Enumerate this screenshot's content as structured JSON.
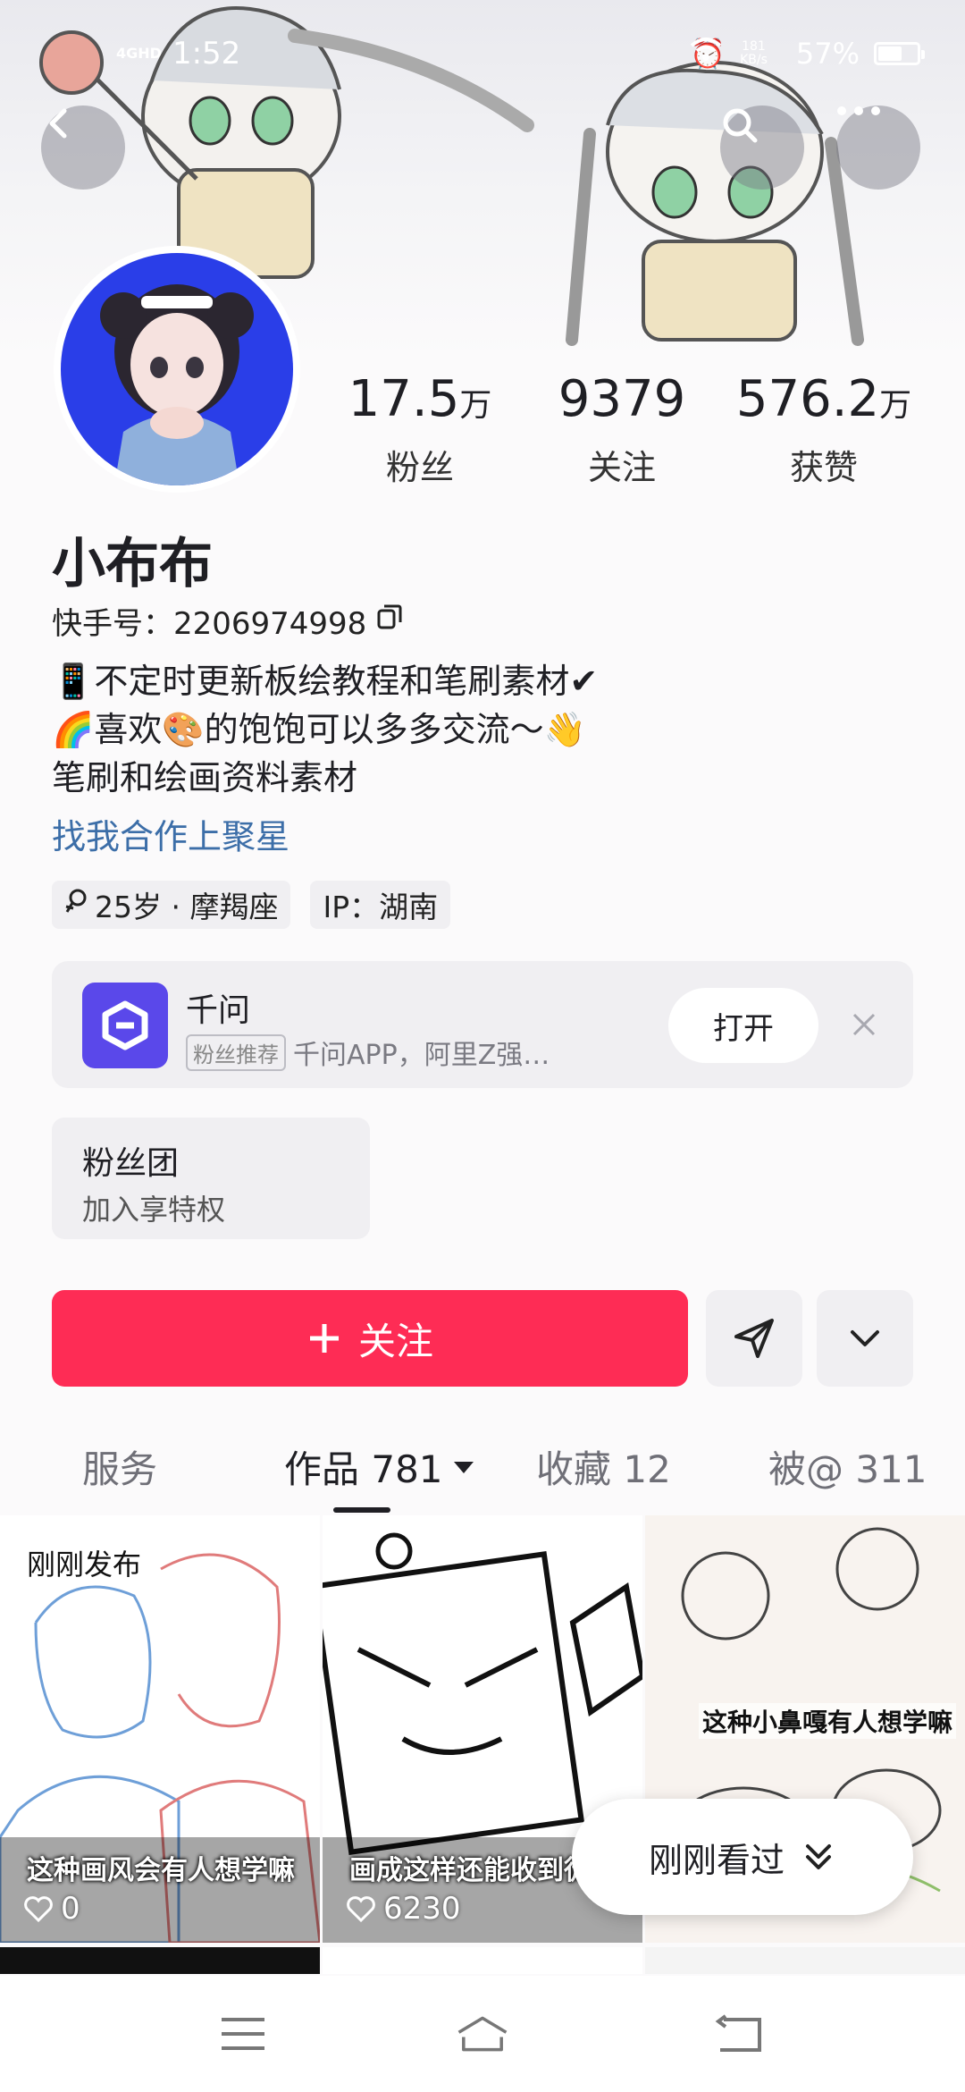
{
  "status_bar": {
    "network": "4GHD",
    "time": "1:52",
    "speed_value": "181",
    "speed_unit": "KB/s",
    "battery": "57%",
    "battery_level": 0.57
  },
  "header": {
    "back_icon": "back-arrow-icon",
    "search_icon": "search-icon",
    "more_icon": "more-dots-icon"
  },
  "profile": {
    "stats": [
      {
        "value": "17.5",
        "unit": "万",
        "label": "粉丝"
      },
      {
        "value": "9379",
        "unit": "",
        "label": "关注"
      },
      {
        "value": "576.2",
        "unit": "万",
        "label": "获赞"
      }
    ],
    "name": "小布布",
    "kuaishou_id": "快手号：2206974998",
    "bio_lines": [
      "📱不定时更新板绘教程和笔刷素材✔",
      "🌈喜欢🎨的饱饱可以多多交流～👋",
      "笔刷和绘画资料素材"
    ],
    "cooperation_link": "找我合作上聚星",
    "tags": [
      "25岁 · 摩羯座",
      "IP：湖南"
    ]
  },
  "promo": {
    "title": "千问",
    "badge": "粉丝推荐",
    "subtitle": "千问APP，阿里Z强…",
    "open_label": "打开"
  },
  "fan_club": {
    "title": "粉丝团",
    "subtitle": "加入享特权"
  },
  "actions": {
    "follow_label": "关注"
  },
  "tabs": [
    {
      "label": "服务"
    },
    {
      "label": "作品 781"
    },
    {
      "label": "收藏 12"
    },
    {
      "label": "被@ 311"
    }
  ],
  "grid": [
    {
      "badge": "刚刚发布",
      "caption": "这种画风会有人想学嘛",
      "likes": "0"
    },
    {
      "caption": "画成这样还能收到徒",
      "likes": "6230"
    },
    {
      "overlay_caption": "这种小鼻嘎有人想学嘛"
    }
  ],
  "recent_button": {
    "label": "刚刚看过"
  },
  "colors": {
    "accent": "#fe2c55",
    "link": "#3c6ea8",
    "promo_logo": "#5a48ea"
  }
}
